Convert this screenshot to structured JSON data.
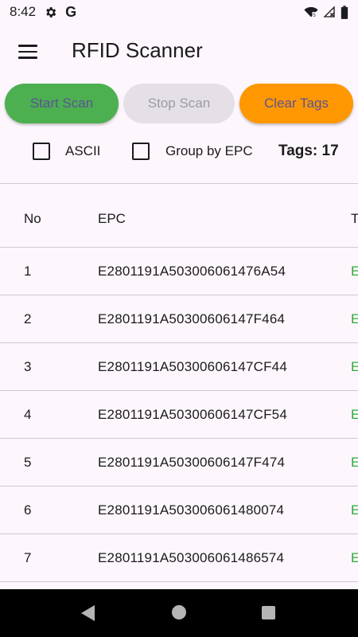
{
  "status_bar": {
    "time": "8:42",
    "left_icons": [
      "gear-icon",
      "google-icon"
    ],
    "google_letter": "G",
    "right_icons": [
      "wifi-icon",
      "no-signal-icon",
      "battery-icon"
    ]
  },
  "app_bar": {
    "menu_icon": "hamburger-menu-icon",
    "title": "RFID Scanner"
  },
  "buttons": {
    "start": "Start Scan",
    "stop": "Stop Scan",
    "clear": "Clear Tags"
  },
  "options": {
    "ascii_label": "ASCII",
    "ascii_checked": false,
    "group_label": "Group by EPC",
    "group_checked": false,
    "tags_count": "Tags: 17"
  },
  "table": {
    "headers": {
      "no": "No",
      "epc": "EPC",
      "type": "T"
    },
    "rows": [
      {
        "no": "1",
        "epc": "E2801191A503006061476A54",
        "type": "E"
      },
      {
        "no": "2",
        "epc": "E2801191A50300606147F464",
        "type": "E"
      },
      {
        "no": "3",
        "epc": "E2801191A50300606147CF44",
        "type": "E"
      },
      {
        "no": "4",
        "epc": "E2801191A50300606147CF54",
        "type": "E"
      },
      {
        "no": "5",
        "epc": "E2801191A50300606147F474",
        "type": "E"
      },
      {
        "no": "6",
        "epc": "E2801191A503006061480074",
        "type": "E"
      },
      {
        "no": "7",
        "epc": "E2801191A503006061486574",
        "type": "E"
      }
    ]
  },
  "nav_bar": {
    "icons": [
      "back-icon",
      "home-icon",
      "recent-apps-icon"
    ]
  },
  "colors": {
    "start_button": "#4caf50",
    "stop_button_disabled": "#e4e0e6",
    "clear_button": "#ff9800",
    "button_text": "#5c5494",
    "type_text": "#2eaa3a",
    "background": "#fdf7fd"
  }
}
